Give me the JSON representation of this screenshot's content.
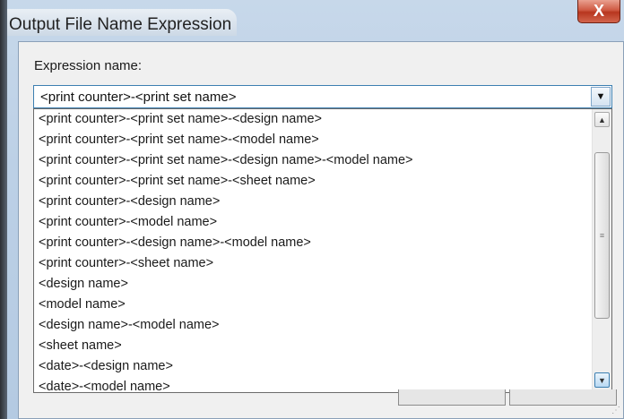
{
  "window": {
    "title": "Output File Name Expression",
    "close_label": "X"
  },
  "form": {
    "expression_label": "Expression name:",
    "selected_value": "<print counter>-<print set name>"
  },
  "dropdown": {
    "items": [
      "<print counter>-<print set name>-<design name>",
      "<print counter>-<print set name>-<model name>",
      "<print counter>-<print set name>-<design name>-<model name>",
      "<print counter>-<print set name>-<sheet name>",
      "<print counter>-<design name>",
      "<print counter>-<model name>",
      "<print counter>-<design name>-<model name>",
      "<print counter>-<sheet name>",
      "<design name>",
      "<model name>",
      "<design name>-<model name>",
      "<sheet name>",
      "<date>-<design name>",
      "<date>-<model name>"
    ]
  },
  "icons": {
    "combo_arrow": "chevron-down-icon",
    "scroll_up": "scroll-up-icon",
    "scroll_down": "scroll-down-icon",
    "thumb_grip": "scroll-grip-icon",
    "resize_grip": "resize-grip-icon"
  }
}
